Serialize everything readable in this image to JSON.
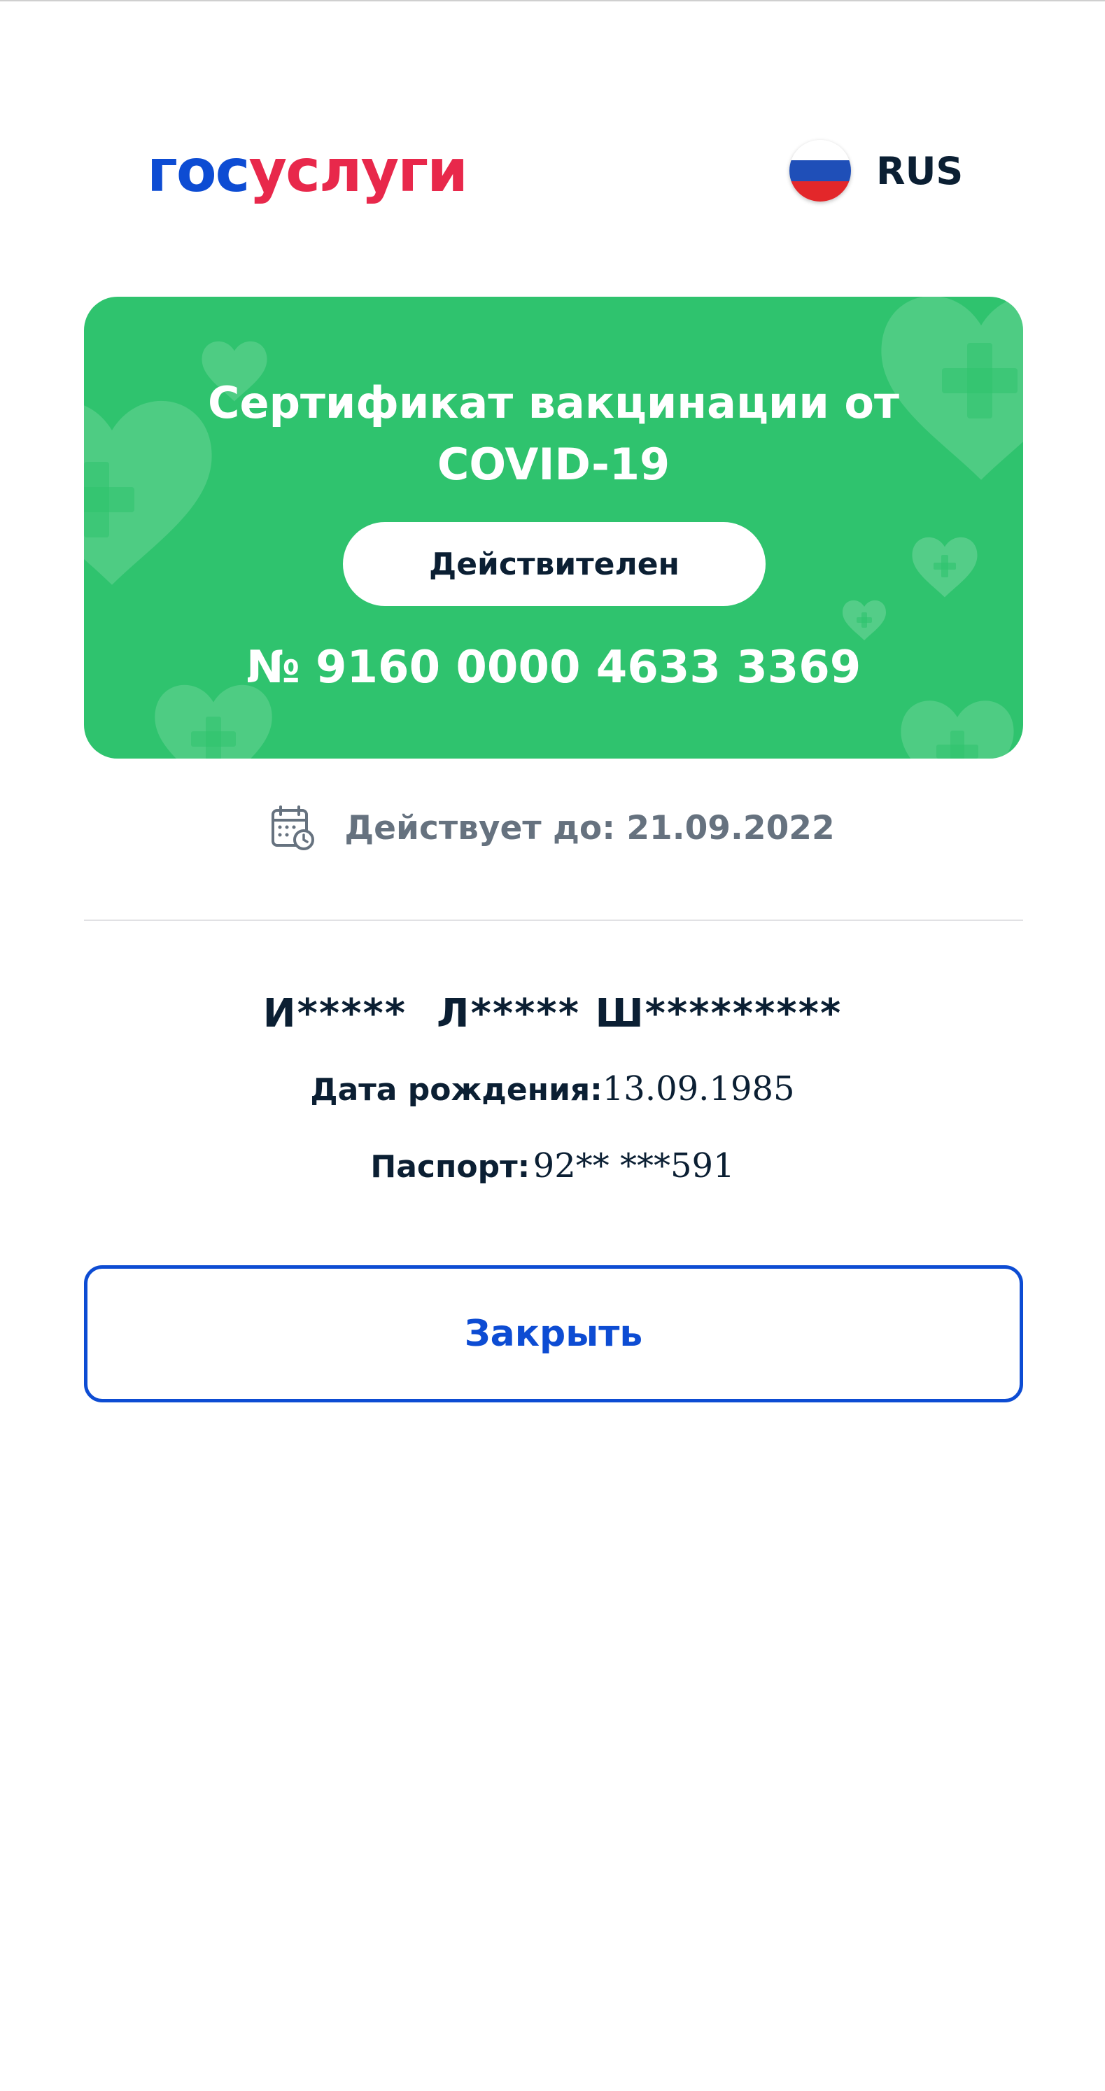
{
  "header": {
    "logo_part1": "гос",
    "logo_part2": "услуги",
    "language_label": "RUS",
    "flag_icon": "russia-flag-icon"
  },
  "certificate": {
    "title": "Сертификат вакцинации от COVID-19",
    "status": "Действителен",
    "number": "№ 9160 0000 4633 3369",
    "valid_until": "Действует до: 21.09.2022"
  },
  "person": {
    "name": "И*****  Л***** Ш*********",
    "birth_label": "Дата рождения:",
    "birth_value": "13.09.1985",
    "passport_label": "Паспорт:",
    "passport_value": "92** ***591"
  },
  "actions": {
    "close_label": "Закрыть"
  },
  "colors": {
    "brand_blue": "#0d4cd3",
    "brand_red": "#e8284b",
    "card_green": "#2fc36e",
    "text_dark": "#0b1f33",
    "text_muted": "#66727f"
  }
}
